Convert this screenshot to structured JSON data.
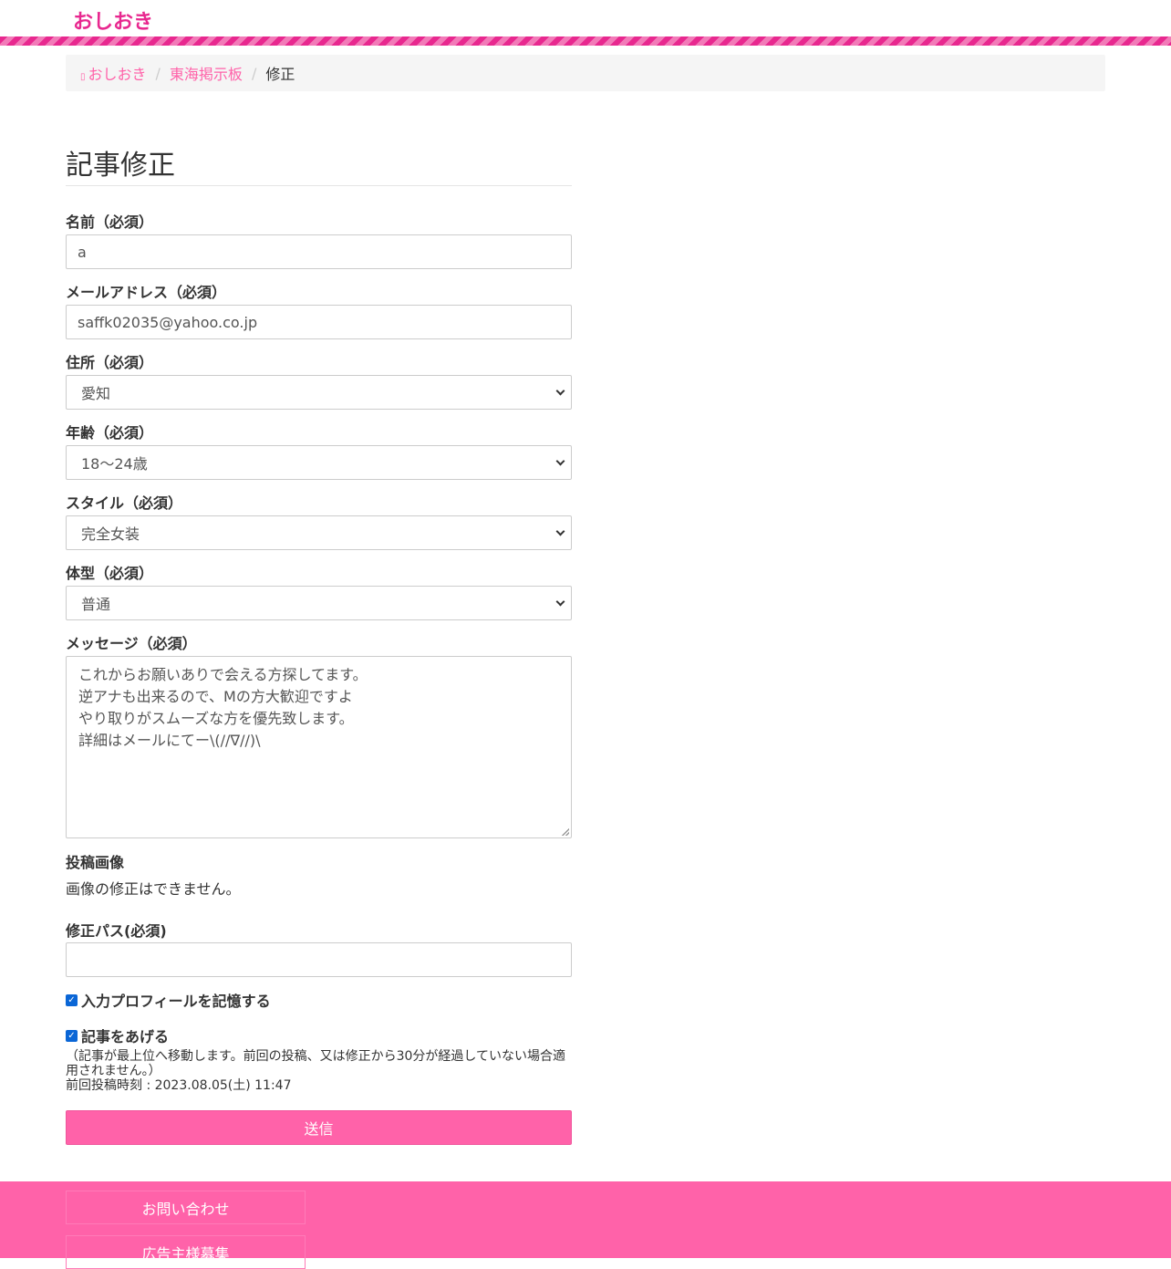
{
  "header": {
    "logo": "おしおき"
  },
  "breadcrumb": {
    "home": "おしおき",
    "board": "東海掲示板",
    "current": "修正"
  },
  "form": {
    "title": "記事修正",
    "name": {
      "label": "名前（必須）",
      "value": "a"
    },
    "email": {
      "label": "メールアドレス（必須）",
      "value": "saffk02035@yahoo.co.jp"
    },
    "address": {
      "label": "住所（必須）",
      "value": "愛知"
    },
    "age": {
      "label": "年齢（必須）",
      "value": "18〜24歳"
    },
    "style": {
      "label": "スタイル（必須）",
      "value": "完全女装"
    },
    "body_type": {
      "label": "体型（必須）",
      "value": "普通"
    },
    "message": {
      "label": "メッセージ（必須）",
      "lines": [
        "これからお願いありで会える方探してます。",
        "逆アナも出来るので、Mの方大歓迎ですよ",
        "やり取りがスムーズな方を優先致します。",
        "詳細はメールにてー\\(//∇//)\\"
      ]
    },
    "image": {
      "label": "投稿画像",
      "note": "画像の修正はできません。"
    },
    "password": {
      "label": "修正パス(必須)",
      "value": ""
    },
    "remember": {
      "label": "入力プロフィールを記憶する",
      "checked": true
    },
    "bump": {
      "label": "記事をあげる",
      "checked": true,
      "note_line1": "（記事が最上位へ移動します。前回の投稿、又は修正から30分が経過していない場合適",
      "note_line2": "用されません。）",
      "last_post": "前回投稿時刻 : 2023.08.05(土) 11:47"
    },
    "submit": "送信"
  },
  "footer": {
    "contact": "お問い合わせ",
    "advertisers": "広告主様募集"
  },
  "colors": {
    "accent": "#ff62a9",
    "logo": "#e8288f",
    "checkbox": "#0a66d6"
  }
}
